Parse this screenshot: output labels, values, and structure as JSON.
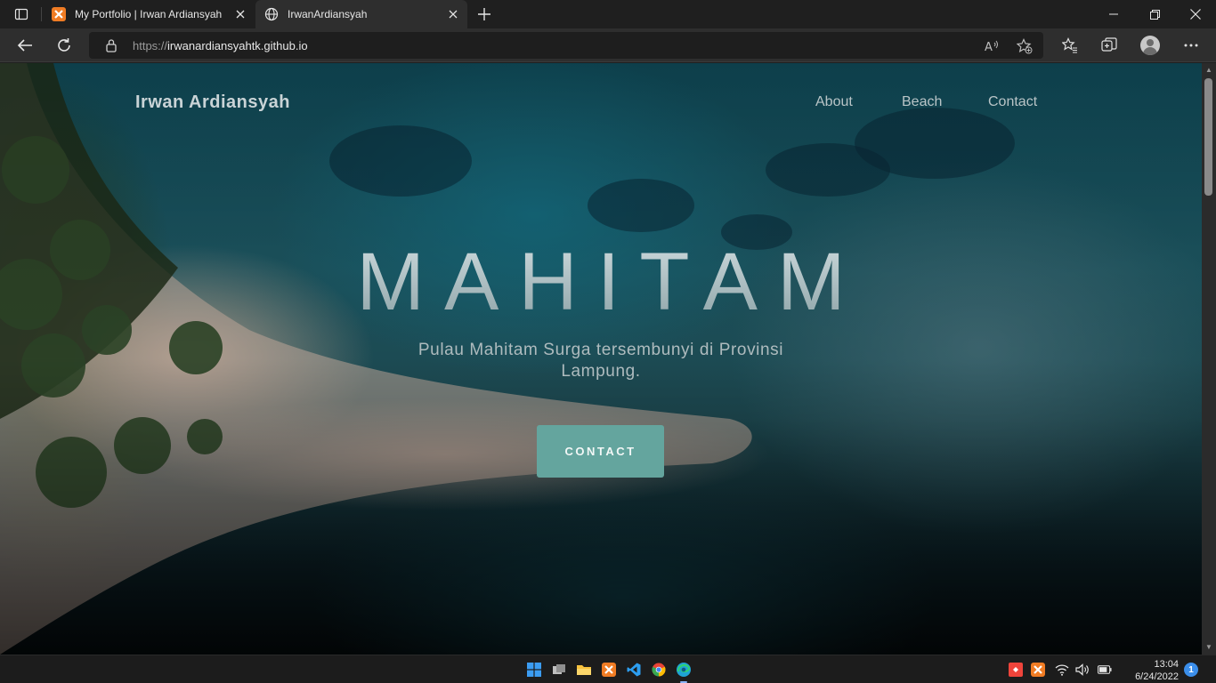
{
  "browser": {
    "tabs": [
      {
        "title": "My Portfolio | Irwan Ardiansyah",
        "active": false
      },
      {
        "title": "IrwanArdiansyah",
        "active": true
      }
    ],
    "address": {
      "scheme": "https://",
      "host": "irwanardiansyahtk.github.io"
    }
  },
  "site": {
    "brand": "Irwan Ardiansyah",
    "nav": [
      "About",
      "Beach",
      "Contact"
    ],
    "hero_title": "MAHITAM",
    "hero_subtitle": "Pulau Mahitam Surga tersembunyi di Provinsi Lampung.",
    "cta_label": "CONTACT",
    "colors": {
      "cta": "#64a59e",
      "brand_text": "#c9d3d6"
    }
  },
  "taskbar": {
    "apps": [
      "windows-start-icon",
      "task-view-icon",
      "file-explorer-icon",
      "xampp-icon",
      "vscode-icon",
      "chrome-icon",
      "edge-icon"
    ],
    "time": "13:04",
    "date": "6/24/2022",
    "notifications": "1"
  }
}
